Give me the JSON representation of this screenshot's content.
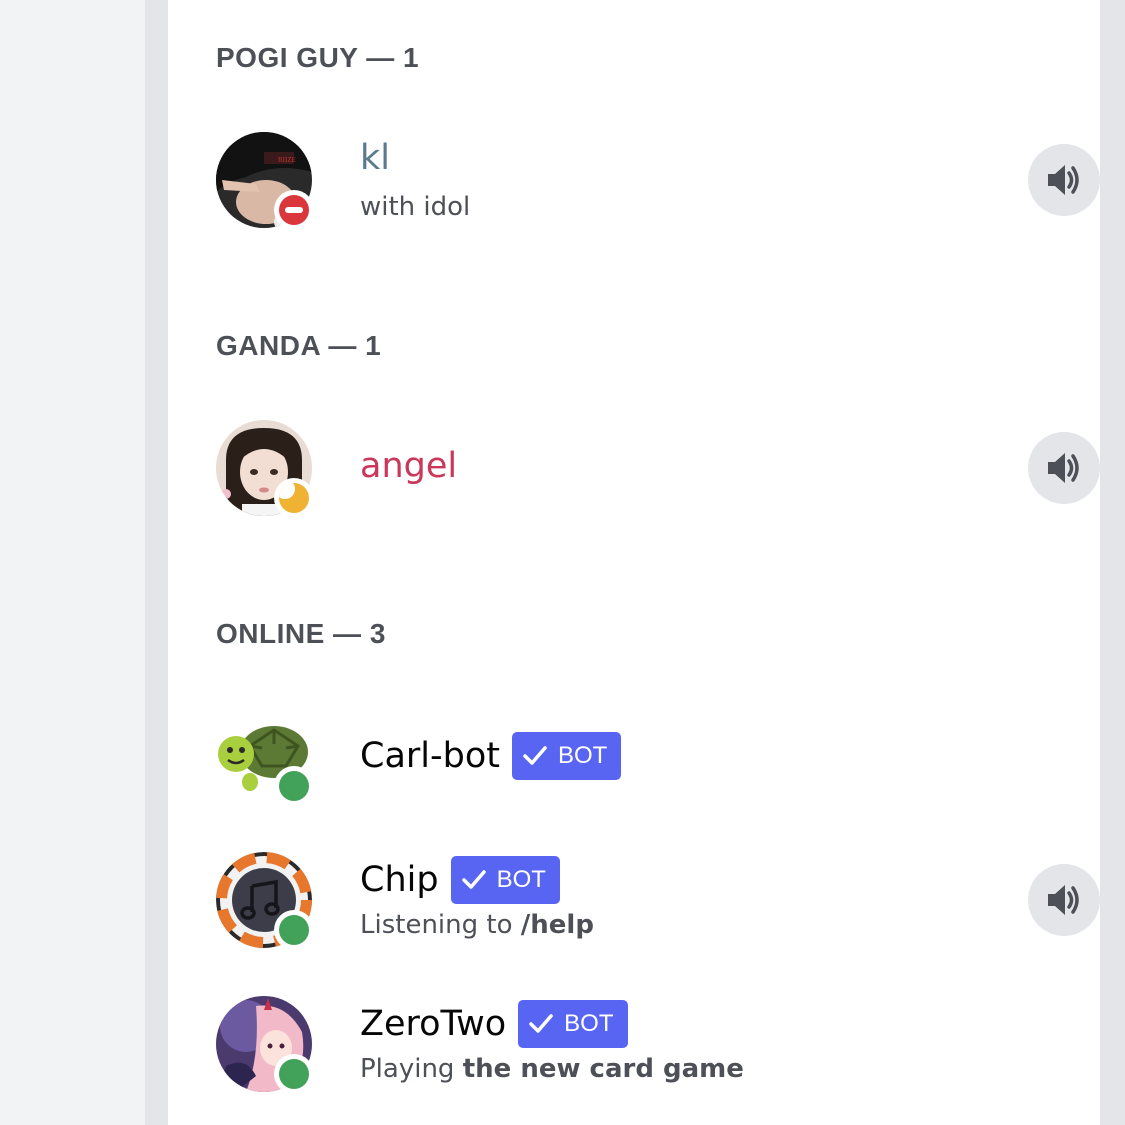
{
  "sections": [
    {
      "header": "POGI GUY — 1",
      "members": [
        {
          "name": "kl",
          "name_color": "#5c7a8e",
          "status": "dnd",
          "activity": "with idol",
          "activity_prefix": "",
          "bot": false,
          "voice": true
        }
      ]
    },
    {
      "header": "GANDA — 1",
      "members": [
        {
          "name": "angel",
          "name_color": "#c9375a",
          "status": "idle",
          "activity": "",
          "activity_prefix": "",
          "bot": false,
          "voice": true
        }
      ]
    },
    {
      "header": "ONLINE — 3",
      "members": [
        {
          "name": "Carl-bot",
          "name_color": "#060607",
          "status": "online",
          "activity": "",
          "activity_prefix": "",
          "bot": true,
          "bot_label": "BOT",
          "voice": false
        },
        {
          "name": "Chip",
          "name_color": "#060607",
          "status": "online",
          "activity_prefix": "Listening to",
          "activity": "/help",
          "bot": true,
          "bot_label": "BOT",
          "voice": true
        },
        {
          "name": "ZeroTwo",
          "name_color": "#060607",
          "status": "online",
          "activity_prefix": "Playing",
          "activity": "the new card game",
          "bot": true,
          "bot_label": "BOT",
          "voice": false
        }
      ]
    }
  ],
  "colors": {
    "bot_badge": "#5865f2",
    "online": "#43a25a",
    "dnd": "#da373c",
    "idle": "#f0b232",
    "header_text": "#4e5058"
  },
  "icons": {
    "voice": "speaker-icon",
    "verified": "checkmark-icon"
  }
}
